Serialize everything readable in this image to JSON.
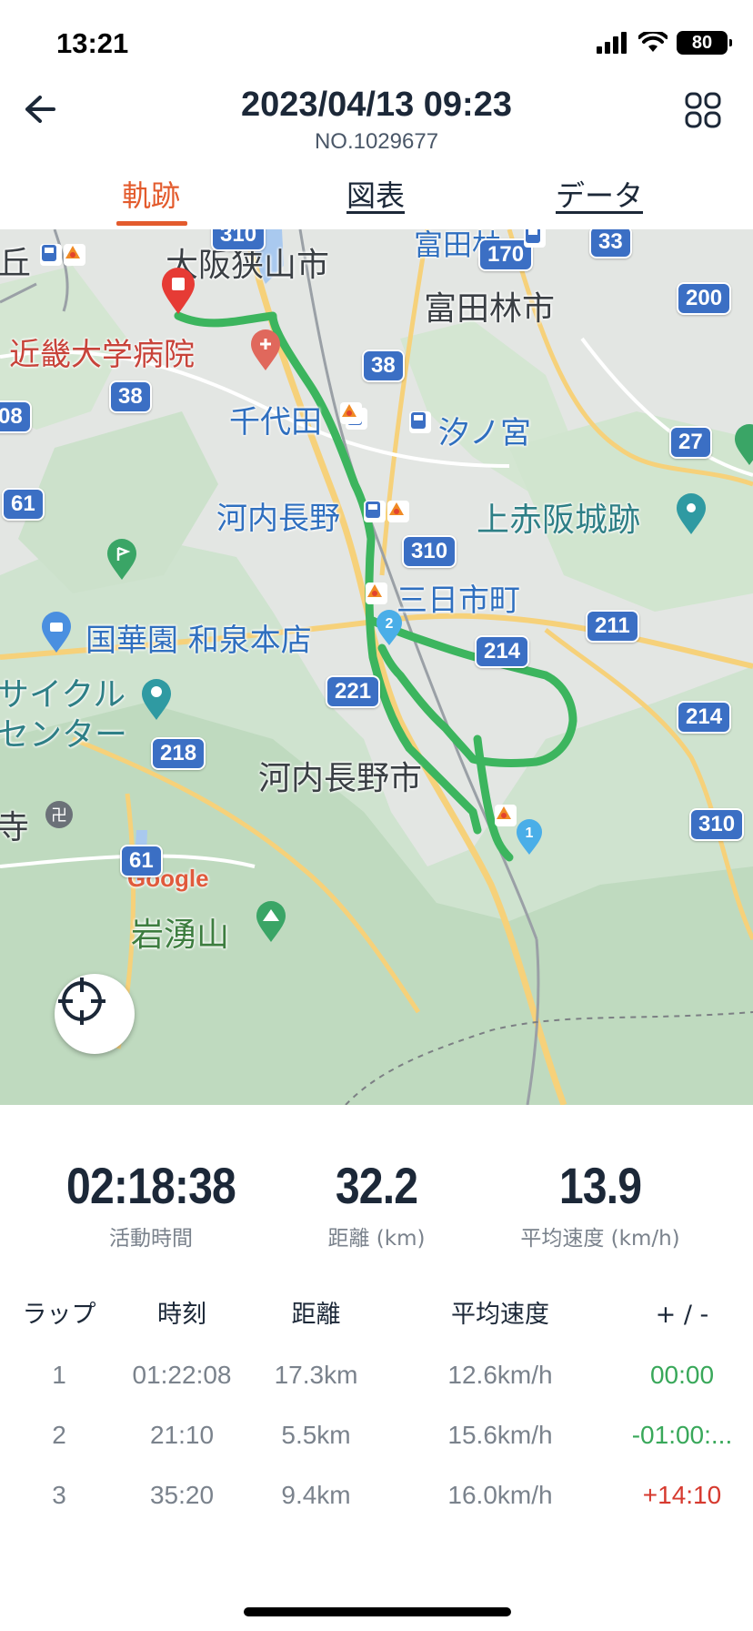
{
  "status_bar": {
    "time": "13:21",
    "battery": "80"
  },
  "header": {
    "title": "2023/04/13 09:23",
    "subtitle": "NO.1029677"
  },
  "tabs": [
    {
      "label": "軌跡",
      "active": true
    },
    {
      "label": "図表",
      "active": false
    },
    {
      "label": "データ",
      "active": false
    }
  ],
  "map": {
    "place_labels": {
      "osakasayama": "大阪狭山市",
      "tondabayashi_top": "富田林",
      "tondabayashi_city": "富田林市",
      "kindai_hospital": "近畿大学病院",
      "chiyoda": "千代田",
      "shionomiya": "汐ノ宮",
      "kawachinagano_station": "河内長野",
      "kamiakasaka": "上赤阪城跡",
      "mikkaichi": "三日市町",
      "kokkaen": "国華園 和泉本店",
      "cycle_1": "サイクル",
      "cycle_2": "センター",
      "kawachinagano_city": "河内長野市",
      "temple": "寺",
      "iwawaki": "岩湧山",
      "hill": "丘",
      "google": "Google"
    },
    "road_badges": [
      "310",
      "170",
      "33",
      "200",
      "38",
      "38",
      "08",
      "27",
      "61",
      "310",
      "211",
      "214",
      "221",
      "214",
      "218",
      "310",
      "61"
    ],
    "markers": {
      "lap1": "1",
      "lap2": "2"
    }
  },
  "stats": [
    {
      "value": "02:18:38",
      "label": "活動時間"
    },
    {
      "value": "32.2",
      "label": "距離 (km)"
    },
    {
      "value": "13.9",
      "label": "平均速度 (km/h)"
    }
  ],
  "laps": {
    "headers": [
      "ラップ",
      "時刻",
      "距離",
      "平均速度",
      "+ / -"
    ],
    "rows": [
      {
        "lap": "1",
        "time": "01:22:08",
        "distance": "17.3km",
        "speed": "12.6km/h",
        "diff": "00:00",
        "diff_color": "#39a85a"
      },
      {
        "lap": "2",
        "time": "21:10",
        "distance": "5.5km",
        "speed": "15.6km/h",
        "diff": "-01:00:...",
        "diff_color": "#39a85a"
      },
      {
        "lap": "3",
        "time": "35:20",
        "distance": "9.4km",
        "speed": "16.0km/h",
        "diff": "+14:10",
        "diff_color": "#d63a2f"
      }
    ]
  },
  "colors": {
    "accent": "#e35b2d",
    "route": "#3cb55e",
    "positive": "#39a85a",
    "negative": "#d63a2f",
    "road_badge": "#3b6fc4"
  }
}
